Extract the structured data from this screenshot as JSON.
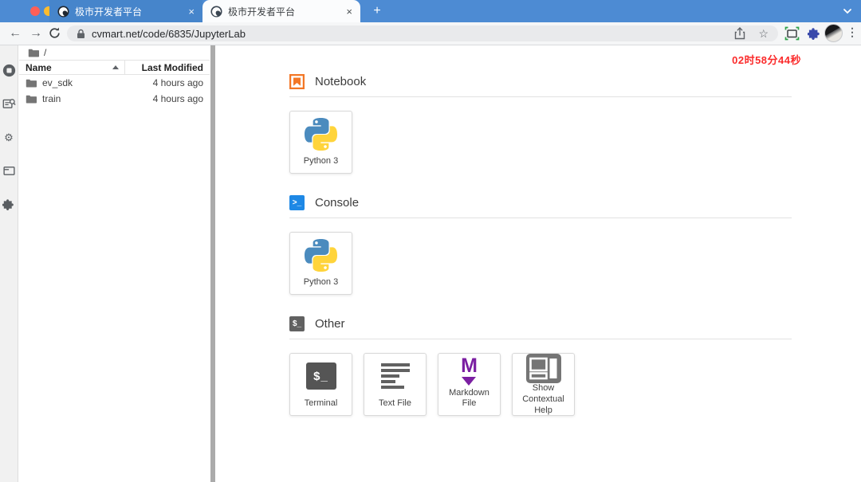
{
  "colors": {
    "chrome_blue": "#4d8bd3",
    "timer_red": "#fb2b2b",
    "jupyter_orange": "#F37726",
    "console_blue": "#1E88E5",
    "markdown_purple": "#7B1FA2",
    "python_blue": "#4B8BBE",
    "python_yellow": "#FFD43B"
  },
  "browser": {
    "tab1": {
      "title": "极市开发者平台",
      "close": "×"
    },
    "tab2": {
      "title": "极市开发者平台",
      "close": "×"
    },
    "new_tab": "+",
    "url": "cvmart.net/code/6835/JupyterLab"
  },
  "icons": {
    "back": "←",
    "forward": "→",
    "star": "☆",
    "dots": "⋮",
    "gears": "⚙",
    "console_glyph": ">_",
    "shell_glyph": "$_",
    "markdown_glyph": "M"
  },
  "page": {
    "timer": "02时58分44秒"
  },
  "file_browser": {
    "breadcrumb": "/",
    "col_name": "Name",
    "col_modified": "Last Modified",
    "rows": [
      {
        "name": "ev_sdk",
        "modified": "4 hours ago"
      },
      {
        "name": "train",
        "modified": "4 hours ago"
      }
    ]
  },
  "launcher": {
    "sections": [
      {
        "title": "Notebook"
      },
      {
        "title": "Console"
      },
      {
        "title": "Other"
      }
    ],
    "cards": {
      "notebook_python": "Python 3",
      "console_python": "Python 3",
      "terminal": "Terminal",
      "text_file": "Text File",
      "markdown": "Markdown File",
      "contextual_help": "Show Contextual Help"
    }
  }
}
